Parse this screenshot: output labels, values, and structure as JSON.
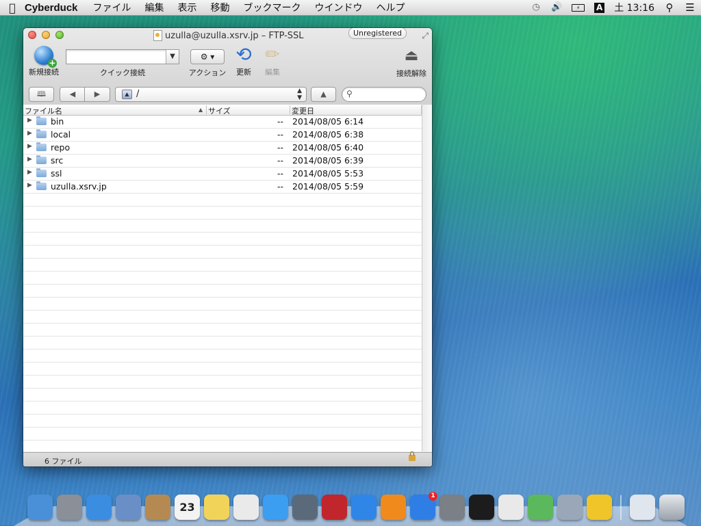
{
  "menubar": {
    "app_name": "Cyberduck",
    "items": [
      "ファイル",
      "編集",
      "表示",
      "移動",
      "ブックマーク",
      "ウインドウ",
      "ヘルプ"
    ],
    "clock": "土 13:16",
    "input_indicator": "A"
  },
  "window": {
    "title": "uzulla@uzulla.xsrv.jp – FTP-SSL",
    "badge": "Unregistered"
  },
  "toolbar": {
    "new_connection": "新規接続",
    "quick_connect": "クイック接続",
    "quick_connect_value": "",
    "action": "アクション",
    "refresh": "更新",
    "edit": "編集",
    "disconnect": "接続解除"
  },
  "nav": {
    "path": "/",
    "search_value": ""
  },
  "table": {
    "headers": {
      "name": "ファイル名",
      "size": "サイズ",
      "modified": "変更日"
    },
    "rows": [
      {
        "name": "bin",
        "size": "--",
        "modified": "2014/08/05 6:14"
      },
      {
        "name": "local",
        "size": "--",
        "modified": "2014/08/05 6:38"
      },
      {
        "name": "repo",
        "size": "--",
        "modified": "2014/08/05 6:40"
      },
      {
        "name": "src",
        "size": "--",
        "modified": "2014/08/05 6:39"
      },
      {
        "name": "ssl",
        "size": "--",
        "modified": "2014/08/05 5:53"
      },
      {
        "name": "uzulla.xsrv.jp",
        "size": "--",
        "modified": "2014/08/05 5:59"
      }
    ]
  },
  "status": {
    "file_count": "6 ファイル"
  },
  "dock": {
    "calendar_day": "23",
    "appstore_badge": "1",
    "apps": [
      {
        "name": "finder",
        "color": "#4a90d9"
      },
      {
        "name": "launchpad",
        "color": "#8a8f98"
      },
      {
        "name": "safari",
        "color": "#3a8de0"
      },
      {
        "name": "mail",
        "color": "#6a8fc7"
      },
      {
        "name": "contacts",
        "color": "#b58a52"
      },
      {
        "name": "calendar",
        "color": "#f3f3f3"
      },
      {
        "name": "notes",
        "color": "#f2d35a"
      },
      {
        "name": "reminders",
        "color": "#eaeaea"
      },
      {
        "name": "messages",
        "color": "#3b9ef0"
      },
      {
        "name": "facetime",
        "color": "#5b6a7a"
      },
      {
        "name": "photo-booth",
        "color": "#c0262b"
      },
      {
        "name": "itunes",
        "color": "#2f86e6"
      },
      {
        "name": "ibooks",
        "color": "#f08a1d"
      },
      {
        "name": "app-store",
        "color": "#2f7ee6"
      },
      {
        "name": "system-preferences",
        "color": "#7b7f86"
      },
      {
        "name": "terminal",
        "color": "#1c1c1c"
      },
      {
        "name": "chrome",
        "color": "#e9e9e9"
      },
      {
        "name": "coda",
        "color": "#5cb85c"
      },
      {
        "name": "settings-app",
        "color": "#9aa7b8"
      },
      {
        "name": "cyberduck",
        "color": "#f0c52a"
      }
    ]
  }
}
